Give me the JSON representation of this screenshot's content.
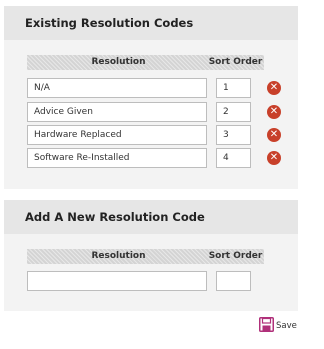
{
  "existing": {
    "title": "Existing Resolution Codes",
    "col_resolution": "Resolution",
    "col_sort": "Sort Order",
    "rows": [
      {
        "resolution": "N/A",
        "sort": "1"
      },
      {
        "resolution": "Advice Given",
        "sort": "2"
      },
      {
        "resolution": "Hardware Replaced",
        "sort": "3"
      },
      {
        "resolution": "Software Re-Installed",
        "sort": "4"
      }
    ],
    "delete_icon": "delete-circle-x-icon"
  },
  "new_code": {
    "title": "Add A New Resolution Code",
    "col_resolution": "Resolution",
    "col_sort": "Sort Order",
    "resolution_value": "",
    "sort_value": ""
  },
  "save": {
    "label": "Save",
    "icon": "floppy-disk-icon"
  },
  "colors": {
    "panel_bg": "#f3f3f3",
    "header_bg": "#e6e6e6",
    "delete_red": "#c8402a",
    "save_icon_magenta": "#b0307a"
  }
}
